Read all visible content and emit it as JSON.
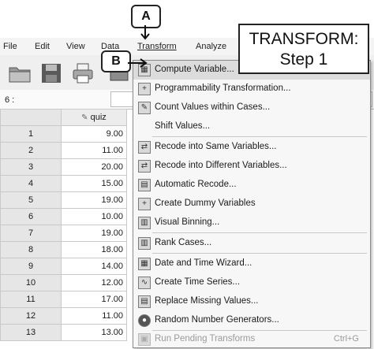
{
  "menubar": {
    "items": [
      {
        "label": "File"
      },
      {
        "label": "Edit"
      },
      {
        "label": "View"
      },
      {
        "label": "Data"
      },
      {
        "label": "Transform"
      },
      {
        "label": "Analyze"
      }
    ]
  },
  "cell": {
    "ref": "6 :"
  },
  "grid": {
    "column_header": "quiz",
    "rows": [
      {
        "n": "1",
        "quiz": "9.00"
      },
      {
        "n": "2",
        "quiz": "11.00"
      },
      {
        "n": "3",
        "quiz": "20.00"
      },
      {
        "n": "4",
        "quiz": "15.00"
      },
      {
        "n": "5",
        "quiz": "19.00"
      },
      {
        "n": "6",
        "quiz": "10.00"
      },
      {
        "n": "7",
        "quiz": "19.00"
      },
      {
        "n": "8",
        "quiz": "18.00"
      },
      {
        "n": "9",
        "quiz": "14.00"
      },
      {
        "n": "10",
        "quiz": "12.00"
      },
      {
        "n": "11",
        "quiz": "17.00"
      },
      {
        "n": "12",
        "quiz": "11.00"
      },
      {
        "n": "13",
        "quiz": "13.00"
      }
    ]
  },
  "transform_menu": {
    "items": [
      {
        "label": "Compute Variable...",
        "icon": "calculator-icon"
      },
      {
        "label": "Programmability Transformation...",
        "icon": "plus-icon"
      },
      {
        "label": "Count Values within Cases...",
        "icon": "count-icon"
      },
      {
        "label": "Shift Values...",
        "icon": ""
      },
      {
        "label": "Recode into Same Variables...",
        "icon": "recode-icon"
      },
      {
        "label": "Recode into Different Variables...",
        "icon": "recode-icon"
      },
      {
        "label": "Automatic Recode...",
        "icon": "auto-recode-icon"
      },
      {
        "label": "Create Dummy Variables",
        "icon": "plus-icon"
      },
      {
        "label": "Visual Binning...",
        "icon": "binning-icon"
      },
      {
        "label": "Rank Cases...",
        "icon": "rank-icon"
      },
      {
        "label": "Date and Time Wizard...",
        "icon": "calendar-icon"
      },
      {
        "label": "Create Time Series...",
        "icon": "time-series-icon"
      },
      {
        "label": "Replace Missing Values...",
        "icon": "replace-icon"
      },
      {
        "label": "Random Number Generators...",
        "icon": "dice-icon"
      },
      {
        "label": "Run Pending Transforms",
        "shortcut": "Ctrl+G",
        "icon": "run-icon"
      }
    ]
  },
  "annotations": {
    "a": "A",
    "b": "B",
    "title_line1": "TRANSFORM:",
    "title_line2": "Step 1"
  }
}
